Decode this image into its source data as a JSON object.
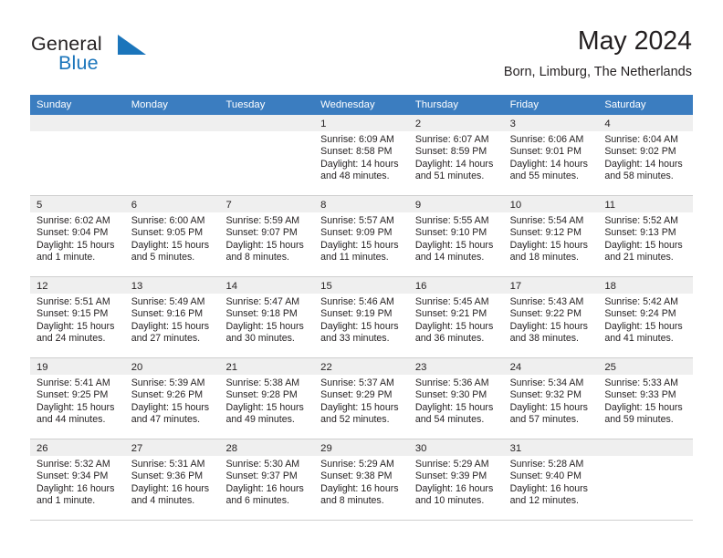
{
  "brand": {
    "name_part1": "General",
    "name_part2": "Blue",
    "mark_icon": "triangle-logo-icon",
    "accent_color": "#1b75bb"
  },
  "header": {
    "title": "May 2024",
    "subtitle": "Born, Limburg, The Netherlands"
  },
  "colors": {
    "header_row_bg": "#3b7dc0",
    "day_number_bg": "#efefef",
    "grid_line": "#cfcfcf",
    "text": "#231f20"
  },
  "weekdays": [
    "Sunday",
    "Monday",
    "Tuesday",
    "Wednesday",
    "Thursday",
    "Friday",
    "Saturday"
  ],
  "weeks": [
    [
      {
        "day": "",
        "empty": true,
        "lines": []
      },
      {
        "day": "",
        "empty": true,
        "lines": []
      },
      {
        "day": "",
        "empty": true,
        "lines": []
      },
      {
        "day": "1",
        "empty": false,
        "lines": [
          "Sunrise: 6:09 AM",
          "Sunset: 8:58 PM",
          "Daylight: 14 hours",
          "and 48 minutes."
        ]
      },
      {
        "day": "2",
        "empty": false,
        "lines": [
          "Sunrise: 6:07 AM",
          "Sunset: 8:59 PM",
          "Daylight: 14 hours",
          "and 51 minutes."
        ]
      },
      {
        "day": "3",
        "empty": false,
        "lines": [
          "Sunrise: 6:06 AM",
          "Sunset: 9:01 PM",
          "Daylight: 14 hours",
          "and 55 minutes."
        ]
      },
      {
        "day": "4",
        "empty": false,
        "lines": [
          "Sunrise: 6:04 AM",
          "Sunset: 9:02 PM",
          "Daylight: 14 hours",
          "and 58 minutes."
        ]
      }
    ],
    [
      {
        "day": "5",
        "empty": false,
        "lines": [
          "Sunrise: 6:02 AM",
          "Sunset: 9:04 PM",
          "Daylight: 15 hours",
          "and 1 minute."
        ]
      },
      {
        "day": "6",
        "empty": false,
        "lines": [
          "Sunrise: 6:00 AM",
          "Sunset: 9:05 PM",
          "Daylight: 15 hours",
          "and 5 minutes."
        ]
      },
      {
        "day": "7",
        "empty": false,
        "lines": [
          "Sunrise: 5:59 AM",
          "Sunset: 9:07 PM",
          "Daylight: 15 hours",
          "and 8 minutes."
        ]
      },
      {
        "day": "8",
        "empty": false,
        "lines": [
          "Sunrise: 5:57 AM",
          "Sunset: 9:09 PM",
          "Daylight: 15 hours",
          "and 11 minutes."
        ]
      },
      {
        "day": "9",
        "empty": false,
        "lines": [
          "Sunrise: 5:55 AM",
          "Sunset: 9:10 PM",
          "Daylight: 15 hours",
          "and 14 minutes."
        ]
      },
      {
        "day": "10",
        "empty": false,
        "lines": [
          "Sunrise: 5:54 AM",
          "Sunset: 9:12 PM",
          "Daylight: 15 hours",
          "and 18 minutes."
        ]
      },
      {
        "day": "11",
        "empty": false,
        "lines": [
          "Sunrise: 5:52 AM",
          "Sunset: 9:13 PM",
          "Daylight: 15 hours",
          "and 21 minutes."
        ]
      }
    ],
    [
      {
        "day": "12",
        "empty": false,
        "lines": [
          "Sunrise: 5:51 AM",
          "Sunset: 9:15 PM",
          "Daylight: 15 hours",
          "and 24 minutes."
        ]
      },
      {
        "day": "13",
        "empty": false,
        "lines": [
          "Sunrise: 5:49 AM",
          "Sunset: 9:16 PM",
          "Daylight: 15 hours",
          "and 27 minutes."
        ]
      },
      {
        "day": "14",
        "empty": false,
        "lines": [
          "Sunrise: 5:47 AM",
          "Sunset: 9:18 PM",
          "Daylight: 15 hours",
          "and 30 minutes."
        ]
      },
      {
        "day": "15",
        "empty": false,
        "lines": [
          "Sunrise: 5:46 AM",
          "Sunset: 9:19 PM",
          "Daylight: 15 hours",
          "and 33 minutes."
        ]
      },
      {
        "day": "16",
        "empty": false,
        "lines": [
          "Sunrise: 5:45 AM",
          "Sunset: 9:21 PM",
          "Daylight: 15 hours",
          "and 36 minutes."
        ]
      },
      {
        "day": "17",
        "empty": false,
        "lines": [
          "Sunrise: 5:43 AM",
          "Sunset: 9:22 PM",
          "Daylight: 15 hours",
          "and 38 minutes."
        ]
      },
      {
        "day": "18",
        "empty": false,
        "lines": [
          "Sunrise: 5:42 AM",
          "Sunset: 9:24 PM",
          "Daylight: 15 hours",
          "and 41 minutes."
        ]
      }
    ],
    [
      {
        "day": "19",
        "empty": false,
        "lines": [
          "Sunrise: 5:41 AM",
          "Sunset: 9:25 PM",
          "Daylight: 15 hours",
          "and 44 minutes."
        ]
      },
      {
        "day": "20",
        "empty": false,
        "lines": [
          "Sunrise: 5:39 AM",
          "Sunset: 9:26 PM",
          "Daylight: 15 hours",
          "and 47 minutes."
        ]
      },
      {
        "day": "21",
        "empty": false,
        "lines": [
          "Sunrise: 5:38 AM",
          "Sunset: 9:28 PM",
          "Daylight: 15 hours",
          "and 49 minutes."
        ]
      },
      {
        "day": "22",
        "empty": false,
        "lines": [
          "Sunrise: 5:37 AM",
          "Sunset: 9:29 PM",
          "Daylight: 15 hours",
          "and 52 minutes."
        ]
      },
      {
        "day": "23",
        "empty": false,
        "lines": [
          "Sunrise: 5:36 AM",
          "Sunset: 9:30 PM",
          "Daylight: 15 hours",
          "and 54 minutes."
        ]
      },
      {
        "day": "24",
        "empty": false,
        "lines": [
          "Sunrise: 5:34 AM",
          "Sunset: 9:32 PM",
          "Daylight: 15 hours",
          "and 57 minutes."
        ]
      },
      {
        "day": "25",
        "empty": false,
        "lines": [
          "Sunrise: 5:33 AM",
          "Sunset: 9:33 PM",
          "Daylight: 15 hours",
          "and 59 minutes."
        ]
      }
    ],
    [
      {
        "day": "26",
        "empty": false,
        "lines": [
          "Sunrise: 5:32 AM",
          "Sunset: 9:34 PM",
          "Daylight: 16 hours",
          "and 1 minute."
        ]
      },
      {
        "day": "27",
        "empty": false,
        "lines": [
          "Sunrise: 5:31 AM",
          "Sunset: 9:36 PM",
          "Daylight: 16 hours",
          "and 4 minutes."
        ]
      },
      {
        "day": "28",
        "empty": false,
        "lines": [
          "Sunrise: 5:30 AM",
          "Sunset: 9:37 PM",
          "Daylight: 16 hours",
          "and 6 minutes."
        ]
      },
      {
        "day": "29",
        "empty": false,
        "lines": [
          "Sunrise: 5:29 AM",
          "Sunset: 9:38 PM",
          "Daylight: 16 hours",
          "and 8 minutes."
        ]
      },
      {
        "day": "30",
        "empty": false,
        "lines": [
          "Sunrise: 5:29 AM",
          "Sunset: 9:39 PM",
          "Daylight: 16 hours",
          "and 10 minutes."
        ]
      },
      {
        "day": "31",
        "empty": false,
        "lines": [
          "Sunrise: 5:28 AM",
          "Sunset: 9:40 PM",
          "Daylight: 16 hours",
          "and 12 minutes."
        ]
      },
      {
        "day": "",
        "empty": true,
        "lines": []
      }
    ]
  ]
}
